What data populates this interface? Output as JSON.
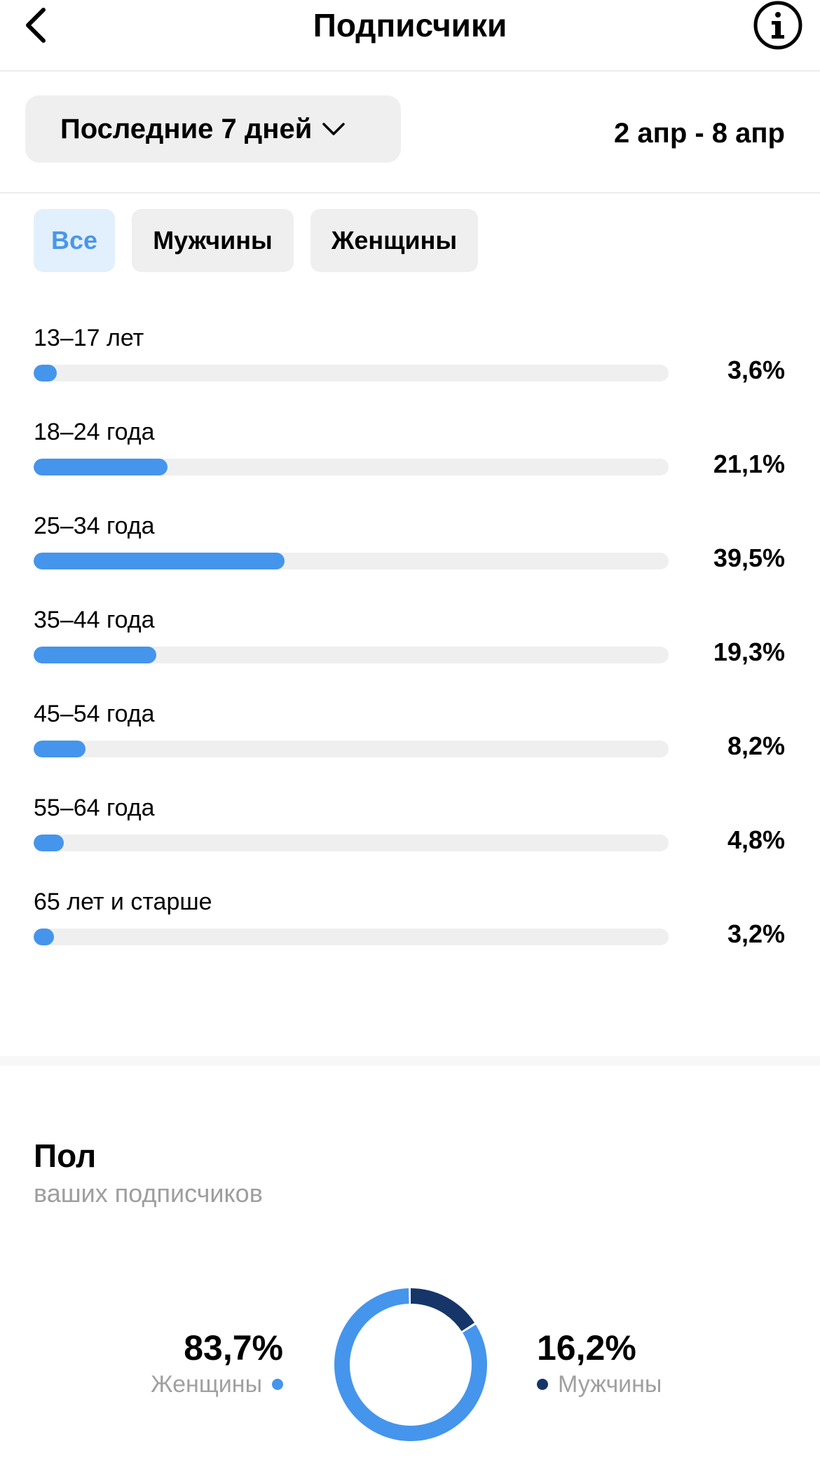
{
  "header": {
    "title": "Подписчики"
  },
  "period": {
    "label": "Последние 7 дней",
    "date_range": "2 апр - 8 апр"
  },
  "filters": [
    {
      "label": "Все",
      "active": true
    },
    {
      "label": "Мужчины",
      "active": false
    },
    {
      "label": "Женщины",
      "active": false
    }
  ],
  "age_groups": [
    {
      "label": "13–17 лет",
      "value_text": "3,6%",
      "value": 3.6
    },
    {
      "label": "18–24 года",
      "value_text": "21,1%",
      "value": 21.1
    },
    {
      "label": "25–34 года",
      "value_text": "39,5%",
      "value": 39.5
    },
    {
      "label": "35–44 года",
      "value_text": "19,3%",
      "value": 19.3
    },
    {
      "label": "45–54 года",
      "value_text": "8,2%",
      "value": 8.2
    },
    {
      "label": "55–64 года",
      "value_text": "4,8%",
      "value": 4.8
    },
    {
      "label": "65 лет и старше",
      "value_text": "3,2%",
      "value": 3.2
    }
  ],
  "gender": {
    "title": "Пол",
    "subtitle": "ваших подписчиков",
    "women": {
      "label": "Женщины",
      "value_text": "83,7%",
      "value": 83.7,
      "color": "#4595ec"
    },
    "men": {
      "label": "Мужчины",
      "value_text": "16,2%",
      "value": 16.2,
      "color": "#16366a"
    }
  },
  "colors": {
    "accent": "#4595ec",
    "accent_dark": "#16366a",
    "chip_active_text": "#4a97e8"
  },
  "icons": {
    "back": "chevron-left-icon",
    "info": "info-icon",
    "dropdown": "chevron-down-icon"
  }
}
